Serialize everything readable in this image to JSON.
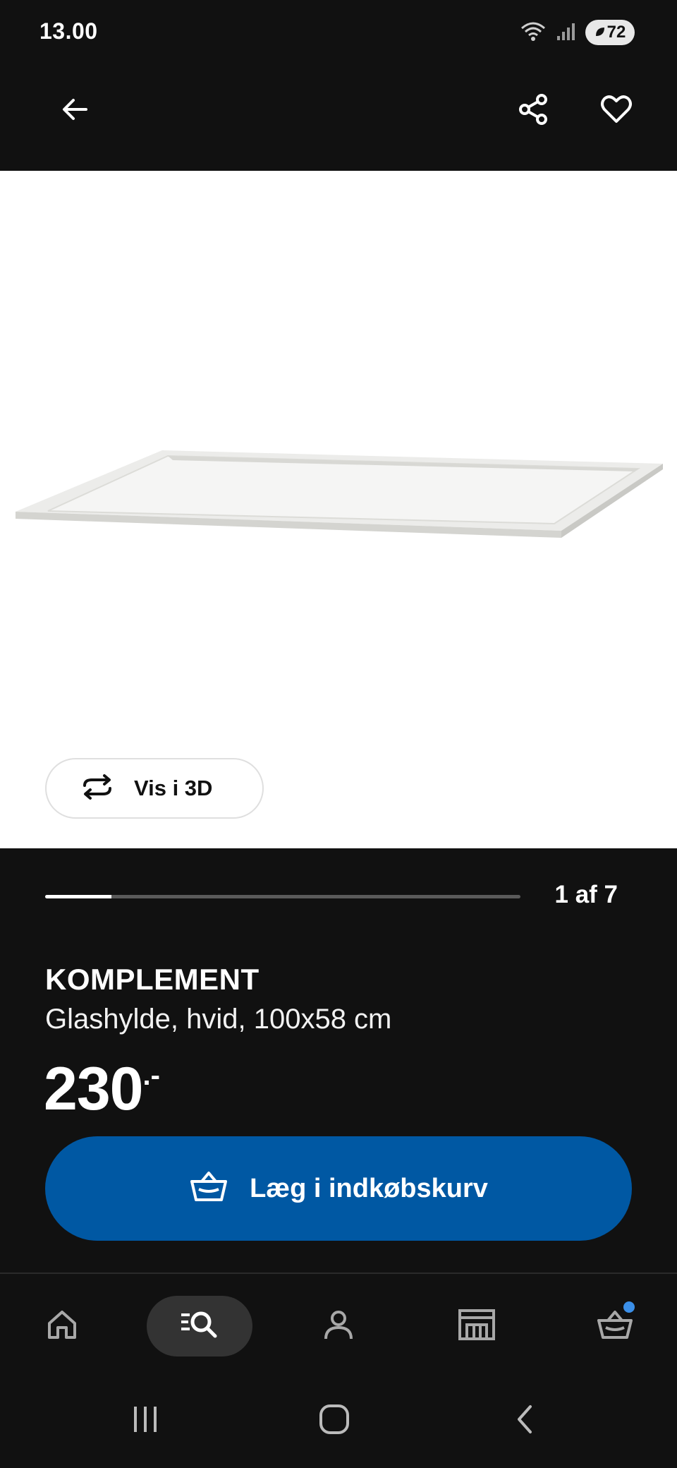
{
  "status_bar": {
    "time": "13.00",
    "battery": "72"
  },
  "gallery": {
    "view_3d_label": "Vis i 3D",
    "pager_text": "1 af 7",
    "progress": 0.14
  },
  "product": {
    "name": "KOMPLEMENT",
    "description": "Glashylde, hvid, 100x58 cm",
    "price_integer": "230",
    "price_suffix": ".-"
  },
  "actions": {
    "add_to_cart_label": "Læg i indkøbskurv"
  },
  "bottom_nav": {
    "items": [
      "home-icon",
      "search-icon",
      "profile-icon",
      "stores-icon",
      "cart-icon"
    ],
    "active": "search-icon",
    "cart_badge_color": "#3b8fe8"
  },
  "colors": {
    "primary_blue": "#0058a3",
    "background": "#111111"
  }
}
